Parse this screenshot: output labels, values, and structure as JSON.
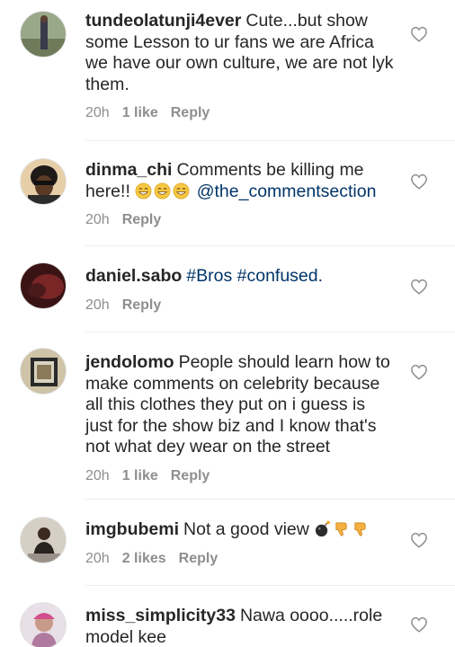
{
  "comments": [
    {
      "username": "tundeolatunji4ever",
      "text": "Cute...but show some Lesson to ur fans we are Africa we have our own culture, we are not lyk them.",
      "time": "20h",
      "likes": "1 like",
      "reply": "Reply",
      "avatar_color": "#8a9a6a"
    },
    {
      "username": "dinma_chi",
      "text": "Comments be killing me here!!",
      "emojis": [
        "grinning-sweat-face",
        "grinning-sweat-face",
        "grinning-sweat-face"
      ],
      "mention": "@the_commentsection",
      "time": "20h",
      "reply": "Reply",
      "avatar_color": "#d8b68a"
    },
    {
      "username": "daniel.sabo",
      "hashtags": "#Bros #confused.",
      "time": "20h",
      "reply": "Reply",
      "avatar_color": "#6e1f1f"
    },
    {
      "username": "jendolomo",
      "text": "People should learn how to make comments on celebrity because all this clothes they put on i guess is just for the show biz and I know that's not what dey wear on the street",
      "time": "20h",
      "likes": "1 like",
      "reply": "Reply",
      "avatar_color": "#b8aa8a"
    },
    {
      "username": "imgbubemi",
      "text": "Not a good view",
      "emojis": [
        "bomb",
        "thumbs-down",
        "thumbs-down"
      ],
      "time": "20h",
      "likes": "2 likes",
      "reply": "Reply",
      "avatar_color": "#b9b2a6"
    },
    {
      "username": "miss_simplicity33",
      "text": "Nawa oooo.....role model kee",
      "avatar_color": "#c9a3b8"
    }
  ],
  "colors": {
    "text": "#262626",
    "meta": "#8e8e8e",
    "link": "#003569",
    "divider": "#efefef"
  },
  "icons": {
    "like": "heart-outline-icon"
  }
}
